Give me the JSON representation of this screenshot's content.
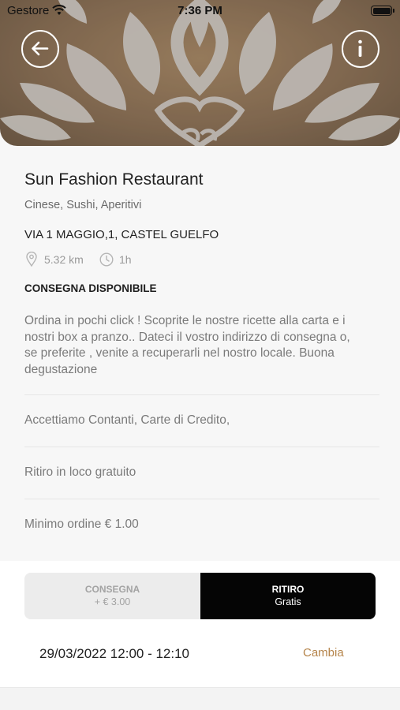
{
  "status_bar": {
    "carrier": "Gestore",
    "time": "7:36 PM"
  },
  "header": {
    "back_icon": "arrow-left-icon",
    "info_icon": "info-icon",
    "image": "lotus-pattern-banner"
  },
  "restaurant": {
    "name": "Sun Fashion Restaurant",
    "categories": "Cinese, Sushi, Aperitivi",
    "address": "VIA 1 MAGGIO,1, CASTEL GUELFO",
    "distance": "5.32 km",
    "time": "1h",
    "delivery_status": "CONSEGNA DISPONIBILE",
    "description": "Ordina in pochi click ! Scoprite le nostre ricette alla carta e i nostri box a pranzo.. Dateci il vostro indirizzo di consegna o, se preferite , venite a recuperarli nel nostro locale. Buona degustazione",
    "payments": "Accettiamo Contanti, Carte di Credito,",
    "pickup_info": "Ritiro in loco gratuito",
    "min_order": "Minimo ordine € 1.00"
  },
  "order_mode": {
    "options": [
      {
        "label": "CONSEGNA",
        "sub": "+ € 3.00",
        "selected": false
      },
      {
        "label": "RITIRO",
        "sub": "Gratis",
        "selected": true
      }
    ]
  },
  "schedule": {
    "datetime": "29/03/2022 12:00 - 12:10",
    "change_label": "Cambia"
  },
  "colors": {
    "accent": "#b5844a",
    "selected_bg": "#050505",
    "unselected_bg": "#ececec"
  }
}
